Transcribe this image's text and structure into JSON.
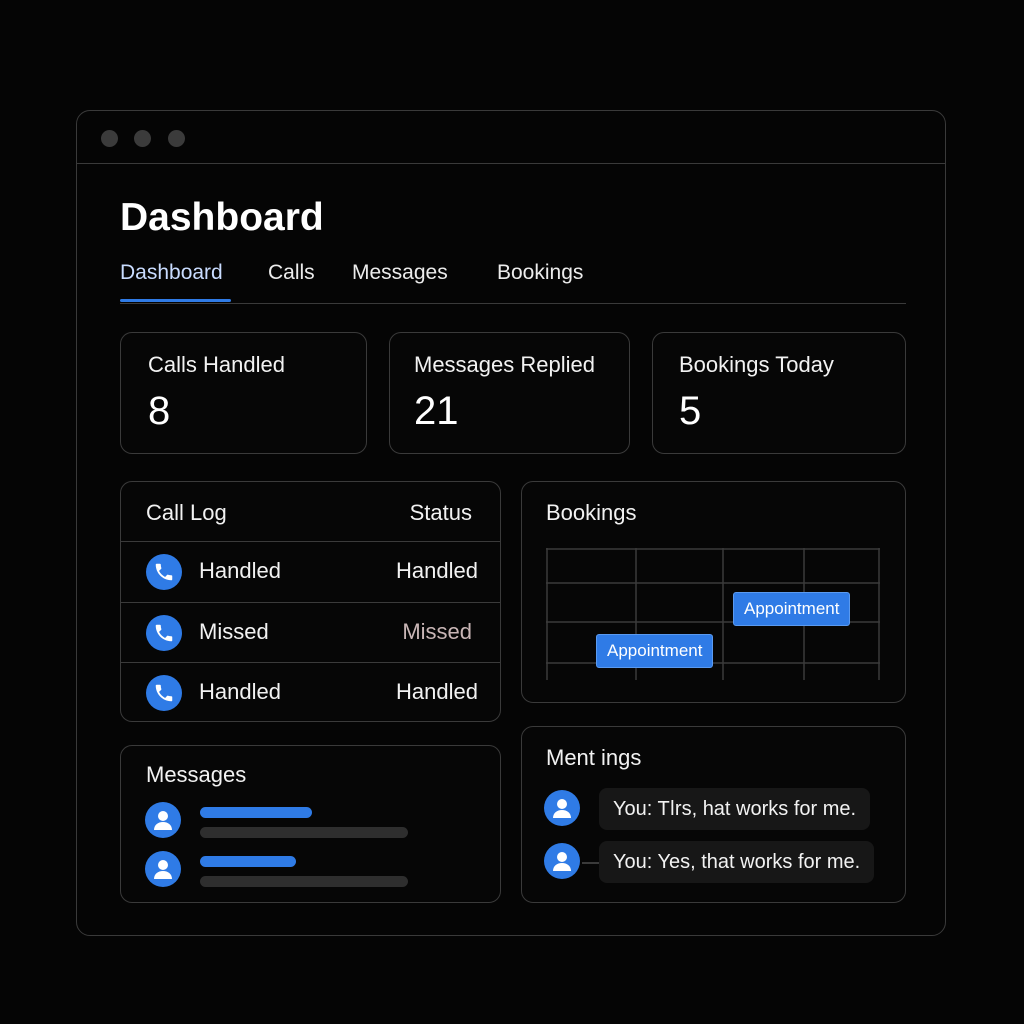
{
  "header": {
    "title": "Dashboard"
  },
  "tabs": [
    {
      "label": "Dashboard",
      "active": true
    },
    {
      "label": "Calls"
    },
    {
      "label": "Messages"
    },
    {
      "label": "Bookings"
    }
  ],
  "stats": [
    {
      "label": "Calls Handled",
      "value": "8"
    },
    {
      "label": "Messages Replied",
      "value": "21"
    },
    {
      "label": "Bookings Today",
      "value": "5"
    }
  ],
  "call_log": {
    "title": "Call Log",
    "status_header": "Status",
    "rows": [
      {
        "name": "Handled",
        "status": "Handled",
        "icon": "phone-icon"
      },
      {
        "name": "Missed",
        "status": "Missed",
        "icon": "phone-icon"
      },
      {
        "name": "Handled",
        "status": "Handled",
        "icon": "phone-icon"
      }
    ]
  },
  "bookings": {
    "title": "Bookings",
    "appointments": [
      {
        "label": "Appointment"
      },
      {
        "label": "Appointment"
      }
    ]
  },
  "messages": {
    "title": "Messages",
    "items": [
      {
        "icon": "user-icon"
      },
      {
        "icon": "user-icon"
      }
    ]
  },
  "meetings": {
    "title": "Ment ings",
    "chats": [
      {
        "text": "You: Tǀrs, hat works for me."
      },
      {
        "text": "You: Yes, that works for me."
      }
    ]
  },
  "colors": {
    "accent": "#2f7be6",
    "background": "#050505",
    "border": "#3a3a3a",
    "missed_text": "#c9b6b6"
  }
}
